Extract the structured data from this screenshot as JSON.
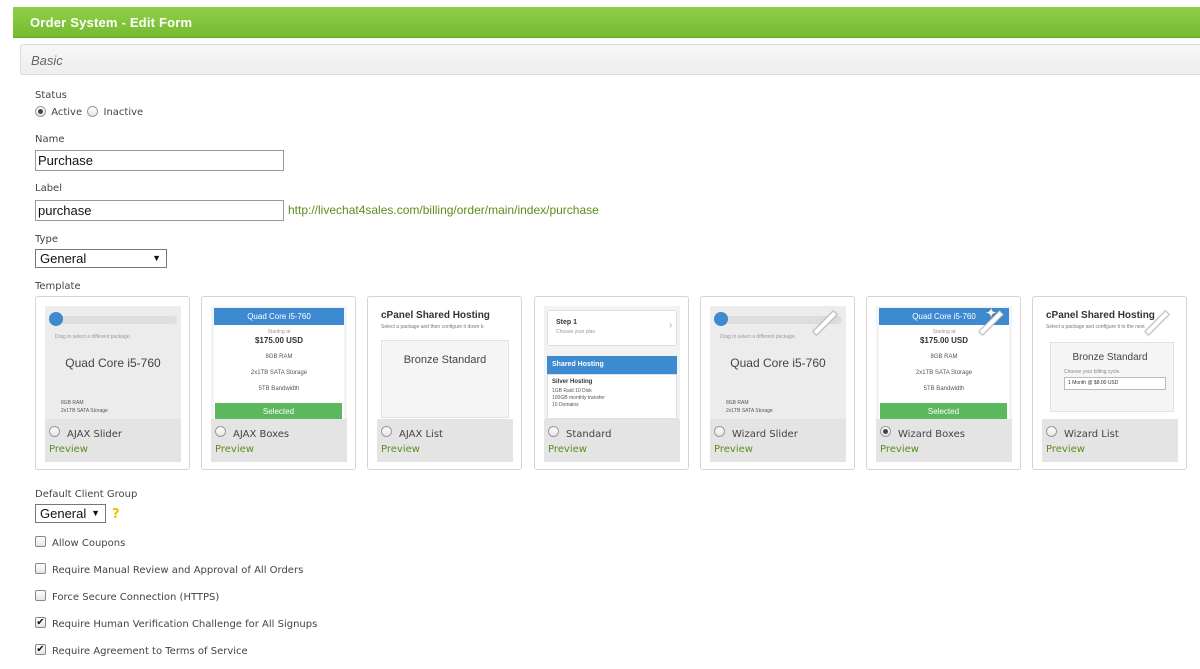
{
  "header": {
    "title": "Order System - Edit Form"
  },
  "section": {
    "title": "Basic"
  },
  "form": {
    "status": {
      "label": "Status",
      "options": [
        {
          "label": "Active",
          "selected": true
        },
        {
          "label": "Inactive",
          "selected": false
        }
      ]
    },
    "name": {
      "label": "Name",
      "value": "Purchase"
    },
    "slug": {
      "label": "Label",
      "value": "purchase",
      "url": "http://livechat4sales.com/billing/order/main/index/purchase"
    },
    "type": {
      "label": "Type",
      "value": "General"
    },
    "template": {
      "label": "Template",
      "items": [
        {
          "name": "AJAX Slider",
          "preview": "Preview",
          "selected": false,
          "thumb": {
            "kind": "slider",
            "hint": "Drag to select a different package.",
            "product": "Quad Core i5-760",
            "specs": [
              "8GB RAM",
              "2x1TB SATA Storage"
            ]
          }
        },
        {
          "name": "AJAX Boxes",
          "preview": "Preview",
          "selected": false,
          "thumb": {
            "kind": "boxes",
            "header": "Quad Core i5-760",
            "starting": "Starting at",
            "price": "$175.00 USD",
            "specs": [
              "8GB RAM",
              "2x1TB SATA Storage",
              "5TB Bandwidth"
            ],
            "button": "Selected"
          }
        },
        {
          "name": "AJAX List",
          "preview": "Preview",
          "selected": false,
          "thumb": {
            "kind": "list",
            "title": "cPanel Shared Hosting",
            "subtitle": "Select a package and then configure it down b",
            "product": "Bronze Standard"
          }
        },
        {
          "name": "Standard",
          "preview": "Preview",
          "selected": false,
          "thumb": {
            "kind": "standard",
            "step": "Step 1",
            "step_sub": "Choose your plan",
            "group": "Shared Hosting",
            "product": "Silver Hosting",
            "specs": [
              "1GB Raid 10 Disk",
              "100GB monthly transfer",
              "10 Domains"
            ]
          }
        },
        {
          "name": "Wizard Slider",
          "preview": "Preview",
          "selected": false,
          "wizard": true,
          "thumb": {
            "kind": "slider",
            "hint": "Drag to select a different package.",
            "product": "Quad Core i5-760",
            "specs": [
              "8GB RAM",
              "2x1TB SATA Storage"
            ]
          }
        },
        {
          "name": "Wizard Boxes",
          "preview": "Preview",
          "selected": true,
          "wizard": true,
          "thumb": {
            "kind": "boxes",
            "header": "Quad Core i5-760",
            "starting": "Starting at",
            "price": "$175.00 USD",
            "specs": [
              "8GB RAM",
              "2x1TB SATA Storage",
              "5TB Bandwidth"
            ],
            "button": "Selected"
          }
        },
        {
          "name": "Wizard List",
          "preview": "Preview",
          "selected": false,
          "wizard": true,
          "thumb": {
            "kind": "wizardlist",
            "title": "cPanel Shared Hosting",
            "subtitle": "Select a package and configure it to the next",
            "product": "Bronze Standard",
            "cycle_hint": "Choose your billing cycle.",
            "cycle": "1 Month @ $8.00 USD"
          }
        }
      ]
    },
    "client_group": {
      "label": "Default Client Group",
      "value": "General"
    },
    "checkboxes": [
      {
        "label": "Allow Coupons",
        "checked": false
      },
      {
        "label": "Require Manual Review and Approval of All Orders",
        "checked": false
      },
      {
        "label": "Force Secure Connection (HTTPS)",
        "checked": false
      },
      {
        "label": "Require Human Verification Challenge for All Signups",
        "checked": true
      },
      {
        "label": "Require Agreement to Terms of Service",
        "checked": true
      }
    ]
  },
  "icons": {
    "help": "question-mark-icon",
    "wizard": "magic-wand-icon"
  },
  "colors": {
    "header": "#7cc13a",
    "link": "#5a8f1b",
    "select_blue": "#3e8ad1",
    "button_green": "#5cb85c"
  }
}
